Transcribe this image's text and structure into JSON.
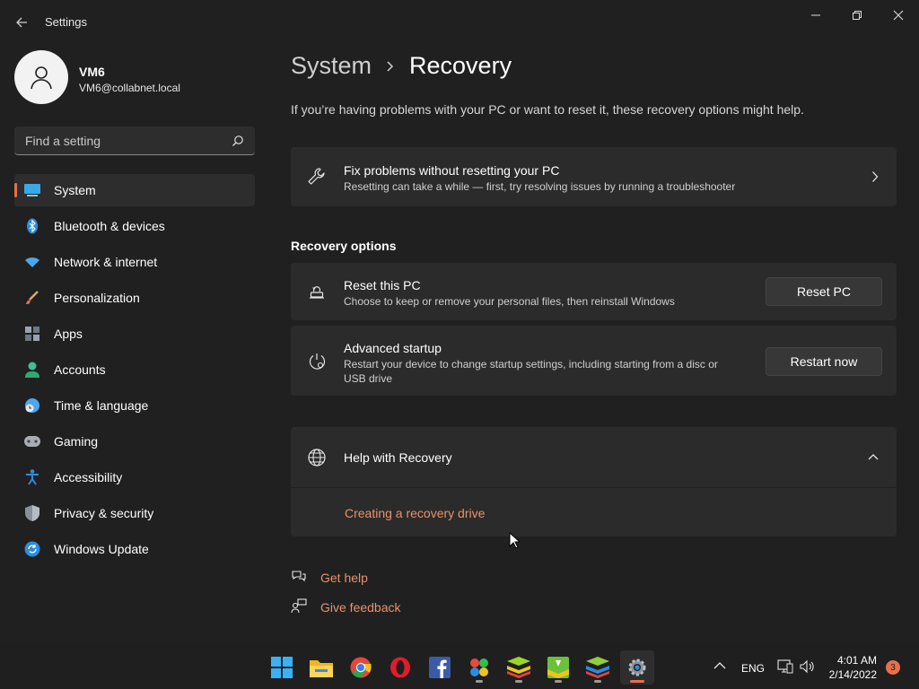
{
  "window": {
    "app_title": "Settings",
    "controls": [
      "minimize-icon",
      "restore-icon",
      "close-icon"
    ]
  },
  "profile": {
    "name": "VM6",
    "email": "VM6@collabnet.local"
  },
  "search": {
    "placeholder": "Find a setting",
    "value": ""
  },
  "nav": {
    "items": [
      {
        "label": "System",
        "icon": "monitor-icon",
        "active": true
      },
      {
        "label": "Bluetooth & devices",
        "icon": "bluetooth-icon"
      },
      {
        "label": "Network & internet",
        "icon": "wifi-icon"
      },
      {
        "label": "Personalization",
        "icon": "brush-icon"
      },
      {
        "label": "Apps",
        "icon": "apps-icon"
      },
      {
        "label": "Accounts",
        "icon": "person-icon"
      },
      {
        "label": "Time & language",
        "icon": "clock-globe-icon"
      },
      {
        "label": "Gaming",
        "icon": "gamepad-icon"
      },
      {
        "label": "Accessibility",
        "icon": "accessibility-icon"
      },
      {
        "label": "Privacy & security",
        "icon": "shield-icon"
      },
      {
        "label": "Windows Update",
        "icon": "update-icon"
      }
    ]
  },
  "breadcrumb": {
    "parent": "System",
    "current": "Recovery"
  },
  "intro": "If you’re having problems with your PC or want to reset it, these recovery options might help.",
  "fix_card": {
    "title": "Fix problems without resetting your PC",
    "description": "Resetting can take a while — first, try resolving issues by running a troubleshooter",
    "icon": "wrench-icon"
  },
  "recovery_options": {
    "heading": "Recovery options",
    "reset": {
      "title": "Reset this PC",
      "description": "Choose to keep or remove your personal files, then reinstall Windows",
      "button": "Reset PC",
      "icon": "reset-pc-icon"
    },
    "advanced": {
      "title": "Advanced startup",
      "description_line1": "Restart your device to change startup settings, including starting from a disc or",
      "description_line2": "USB drive",
      "button": "Restart now",
      "icon": "advanced-startup-icon"
    }
  },
  "help": {
    "title": "Help with Recovery",
    "expanded": true,
    "link": "Creating a recovery drive",
    "icon": "globe-icon"
  },
  "footer_links": {
    "get_help": "Get help",
    "give_feedback": "Give feedback"
  },
  "taskbar": {
    "apps": [
      "start-icon",
      "file-explorer-icon",
      "chrome-icon",
      "opera-icon",
      "facebook-icon",
      "gallery-app-icon",
      "bluestacks-icon",
      "bluestacks-icon",
      "bluestacks-icon",
      "settings-icon"
    ],
    "tray": {
      "language": "ENG",
      "time": "4:01 AM",
      "date": "2/14/2022",
      "notifications": "3"
    }
  },
  "colors": {
    "background": "#202020",
    "card": "#2b2b2b",
    "accent": "#e86f4a",
    "link": "#e8926b"
  }
}
